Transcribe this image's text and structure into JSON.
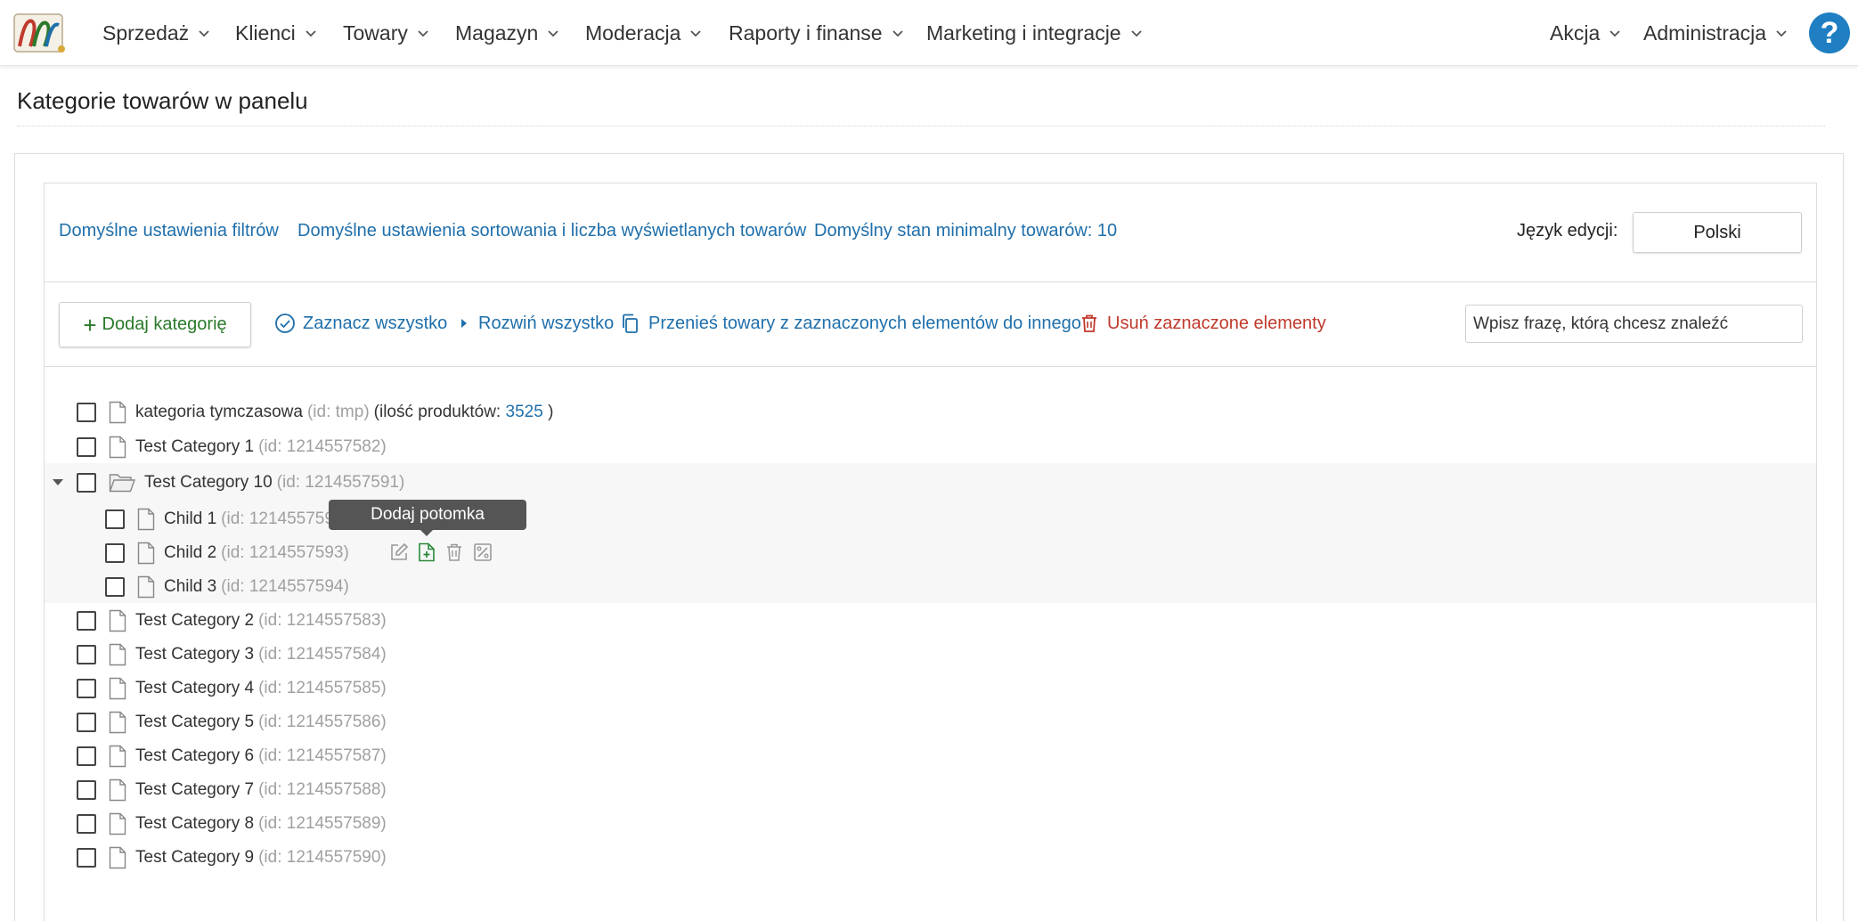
{
  "nav": {
    "items": [
      {
        "label": "Sprzedaż"
      },
      {
        "label": "Klienci"
      },
      {
        "label": "Towary"
      },
      {
        "label": "Magazyn"
      },
      {
        "label": "Moderacja"
      },
      {
        "label": "Raporty i finanse"
      },
      {
        "label": "Marketing i integracje"
      }
    ],
    "right_items": [
      {
        "label": "Akcja"
      },
      {
        "label": "Administracja"
      }
    ],
    "help_label": "?"
  },
  "page": {
    "title": "Kategorie towarów w panelu"
  },
  "settings": {
    "filters_link": "Domyślne ustawienia filtrów",
    "sorting_link": "Domyślne ustawienia sortowania i liczba wyświetlanych towarów",
    "min_stock_link": "Domyślny stan minimalny towarów: 10",
    "lang_label": "Język edycji:",
    "lang_value": "Polski"
  },
  "toolbar": {
    "add_label": "Dodaj kategorię",
    "select_all": "Zaznacz wszystko",
    "expand_all": "Rozwiń wszystko",
    "move_products": "Przenieś towary z zaznaczonych elementów do innego",
    "delete_selected": "Usuń zaznaczone elementy",
    "search_placeholder": "Wpisz frazę, którą chcesz znaleźć"
  },
  "tree": {
    "temp": {
      "name": "kategoria tymczasowa",
      "id": "(id: tmp)",
      "count_prefix": "(ilość produktów:",
      "count": "3525",
      "count_suffix": ")"
    },
    "items": [
      {
        "name": "Test Category 1",
        "id": "(id: 1214557582)"
      },
      {
        "name": "Test Category 10",
        "id": "(id: 1214557591)"
      },
      {
        "name": "Child 1",
        "id": "(id: 121455759"
      },
      {
        "name": "Child 2",
        "id": "(id: 1214557593)"
      },
      {
        "name": "Child 3",
        "id": "(id: 1214557594)"
      },
      {
        "name": "Test Category 2",
        "id": "(id: 1214557583)"
      },
      {
        "name": "Test Category 3",
        "id": "(id: 1214557584)"
      },
      {
        "name": "Test Category 4",
        "id": "(id: 1214557585)"
      },
      {
        "name": "Test Category 5",
        "id": "(id: 1214557586)"
      },
      {
        "name": "Test Category 6",
        "id": "(id: 1214557587)"
      },
      {
        "name": "Test Category 7",
        "id": "(id: 1214557588)"
      },
      {
        "name": "Test Category 8",
        "id": "(id: 1214557589)"
      },
      {
        "name": "Test Category 9",
        "id": "(id: 1214557590)"
      }
    ]
  },
  "tooltip": {
    "text": "Dodaj potomka"
  },
  "colors": {
    "link": "#1f6fab",
    "danger": "#c0392b",
    "success": "#2a7a2a",
    "help": "#1f7fc2"
  }
}
